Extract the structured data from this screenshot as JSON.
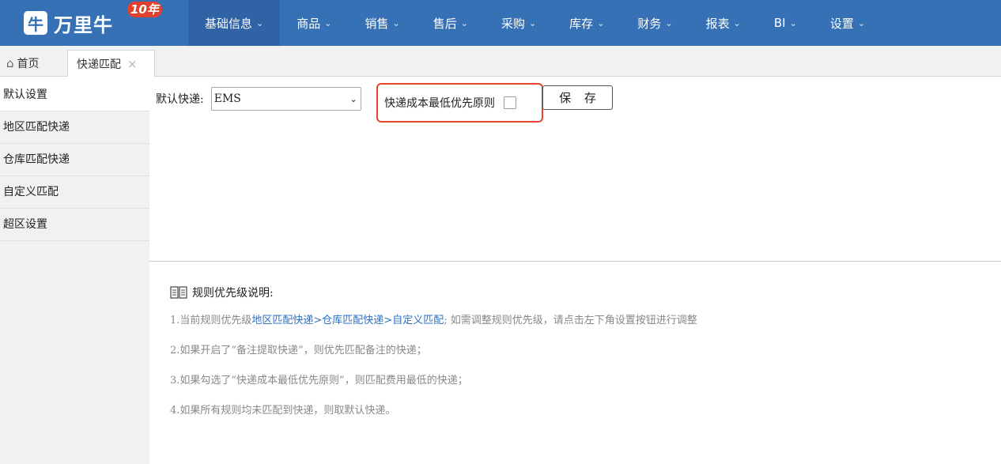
{
  "brand": {
    "name": "万里牛",
    "mark": "牛",
    "badge": "10年"
  },
  "nav": [
    {
      "label": "基础信息",
      "active": true
    },
    {
      "label": "商品"
    },
    {
      "label": "销售"
    },
    {
      "label": "售后"
    },
    {
      "label": "采购"
    },
    {
      "label": "库存"
    },
    {
      "label": "财务"
    },
    {
      "label": "报表"
    },
    {
      "label": "BI"
    },
    {
      "label": "设置"
    }
  ],
  "tabs": {
    "home": "首页",
    "active": "快递匹配"
  },
  "sidebar": [
    {
      "label": "默认设置",
      "active": true
    },
    {
      "label": "地区匹配快递"
    },
    {
      "label": "仓库匹配快递"
    },
    {
      "label": "自定义匹配"
    },
    {
      "label": "超区设置"
    }
  ],
  "form": {
    "default_label": "默认快递:",
    "selected": "EMS",
    "rule_label": "快递成本最低优先原则",
    "rule_checked": false,
    "save_label": "保 存"
  },
  "notes": {
    "title": "规则优先级说明:",
    "line1_prefix": "1.当前规则优先级",
    "line1_link": "地区匹配快递>仓库匹配快递>自定义匹配",
    "line1_suffix": "; 如需调整规则优先级，请点击左下角设置按钮进行调整",
    "line2": "2.如果开启了“备注提取快递”，则优先匹配备注的快递；",
    "line3": "3.如果勾选了“快递成本最低优先原则”，则匹配费用最低的快递；",
    "line4": "4.如果所有规则均未匹配到快递，则取默认快递。"
  },
  "colors": {
    "nav_bg": "#3670b5",
    "highlight": "#e8432f",
    "link": "#2f6fc0"
  }
}
